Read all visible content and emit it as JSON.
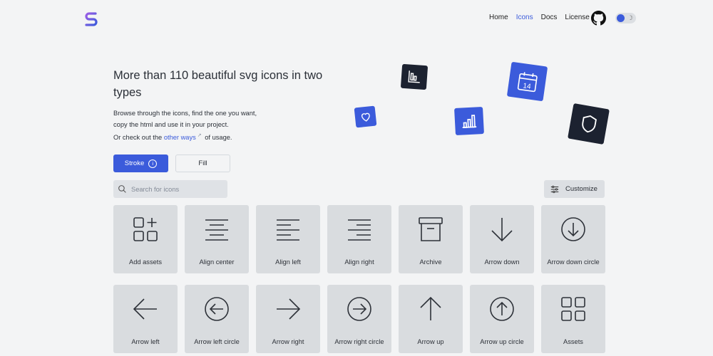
{
  "header": {
    "logo_icon": "brand-s-logo",
    "nav": [
      {
        "label": "Home",
        "active": false
      },
      {
        "label": "Icons",
        "active": true
      },
      {
        "label": "Docs",
        "active": false
      },
      {
        "label": "License",
        "active": false
      }
    ],
    "github_icon": "github-icon",
    "theme_toggle_icon": "moon-icon",
    "accent": "#3b5bdb"
  },
  "hero": {
    "title": "More than 110 beautiful svg icons in two types",
    "desc_line1": "Browse through the icons, find the one you want,",
    "desc_line2": "copy the html and use it in your project.",
    "desc_line3_before": "Or check out the",
    "desc_link": "other ways",
    "desc_line3_after": "of usage.",
    "tile_calendar_number": "14"
  },
  "toolbar": {
    "stroke_label": "Stroke",
    "info_glyph": "i",
    "fill_label": "Fill",
    "search_placeholder": "Search for icons",
    "customize_label": "Customize"
  },
  "icons": [
    {
      "name": "Add assets",
      "icon": "add-assets-icon"
    },
    {
      "name": "Align center",
      "icon": "align-center-icon"
    },
    {
      "name": "Align left",
      "icon": "align-left-icon"
    },
    {
      "name": "Align right",
      "icon": "align-right-icon"
    },
    {
      "name": "Archive",
      "icon": "archive-icon"
    },
    {
      "name": "Arrow down",
      "icon": "arrow-down-icon"
    },
    {
      "name": "Arrow down circle",
      "icon": "arrow-down-circle-icon"
    },
    {
      "name": "Arrow left",
      "icon": "arrow-left-icon"
    },
    {
      "name": "Arrow left circle",
      "icon": "arrow-left-circle-icon"
    },
    {
      "name": "Arrow right",
      "icon": "arrow-right-icon"
    },
    {
      "name": "Arrow right circle",
      "icon": "arrow-right-circle-icon"
    },
    {
      "name": "Arrow up",
      "icon": "arrow-up-icon"
    },
    {
      "name": "Arrow up circle",
      "icon": "arrow-up-circle-icon"
    },
    {
      "name": "Assets",
      "icon": "assets-icon"
    }
  ]
}
